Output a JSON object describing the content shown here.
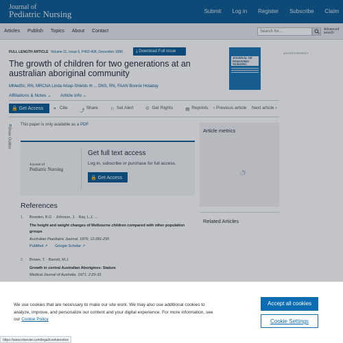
{
  "header": {
    "logo_line1": "Journal of",
    "logo_line2": "Pediatric Nursing",
    "nav": [
      "Submit",
      "Log in",
      "Register",
      "Subscribe",
      "Claim"
    ]
  },
  "subnav": {
    "items": [
      "Articles",
      "Publish",
      "Topics",
      "About",
      "Contact"
    ],
    "search_placeholder": "Search for...",
    "advanced_line1": "Advanced",
    "advanced_line2": "search"
  },
  "article": {
    "type": "FULL LENGTH ARTICLE",
    "volume_info": "Volume 11, Issue 6, P402-408, December 1996",
    "download_label": "Download Full Issue",
    "title": "The growth of children for two generations at an australian aboriginal community",
    "authors": "MMedSc, RN, MRCNA Linda Alsop-Shields ✉ ... DNS, RN, FAAN Bonnie Holaday",
    "affiliations_label": "Affiliations & Notes ⌄",
    "article_info_label": "Article Info ⌄",
    "cover_title": "JOURNAL OF PEDIATRIC NURSING"
  },
  "advertisement": "ADVERTISEMENT",
  "toolbar": {
    "access_label": "Get Access",
    "cite": "Cite",
    "share": "Share",
    "set_alert": "Set Alert",
    "get_rights": "Get Rights",
    "reprints": "Reprints",
    "prev": "Previous article",
    "next": "Next article"
  },
  "outline": {
    "label": "Show Outline"
  },
  "pdf_note": {
    "text": "This paper is only available as a",
    "pdf": "PDF"
  },
  "access_box": {
    "logo_line1": "Journal of",
    "logo_line2": "Pediatric Nursing",
    "title": "Get full text access",
    "subtitle": "Log in, subscribe or purchase for full access.",
    "button": "Get Access"
  },
  "references": {
    "title": "References",
    "items": [
      {
        "num": "1.",
        "authors": "Bowden, B.D. · Johnson, J. · Ray, L.J. ...",
        "title": "The height and weight changes of Melbourne children compared with other population groups",
        "source": "Australian Paediatric Journal. 1976; 12:281-295",
        "links": [
          "PubMed ↗",
          "Google Scholar ↗"
        ]
      },
      {
        "num": "2.",
        "authors": "Brown, T. · Barrett, M.J.",
        "title": "Growth in central Australian Aborigines: Stature",
        "source": "Medical Journal of Australia. 1971; 2:29-33"
      }
    ]
  },
  "sidebar": {
    "metrics_title": "Article metrics",
    "related_title": "Related Articles"
  },
  "cookie": {
    "message": "We use cookies that are necessary to make our site work. We may also use additional cookies to analyze, improve, and personalize our content and your digital experience. For more information, see our",
    "policy_link": "Cookie Policy",
    "accept_label": "Accept all cookies",
    "settings_label": "Cookie Settings"
  },
  "status_url": "https://www.elsevier.com/legal/cookienotice",
  "colors": {
    "brand": "#0b5b93",
    "accent": "#0b6cb3"
  }
}
